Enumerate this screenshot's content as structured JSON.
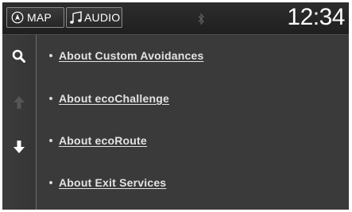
{
  "header": {
    "map_label": "MAP",
    "audio_label": "AUDIO",
    "clock": "12:34"
  },
  "rail": {
    "search_icon": "search-icon",
    "up_icon": "arrow-up-icon",
    "down_icon": "arrow-down-icon",
    "up_enabled": false,
    "down_enabled": true
  },
  "list": {
    "items": [
      {
        "label": "About Custom Avoidances"
      },
      {
        "label": "About ecoChallenge"
      },
      {
        "label": "About ecoRoute"
      },
      {
        "label": "About Exit Services"
      }
    ]
  },
  "colors": {
    "background": "#3a3a3a",
    "topbar": "#242424",
    "text": "#e3e3e3",
    "disabled_icon": "#555555"
  }
}
